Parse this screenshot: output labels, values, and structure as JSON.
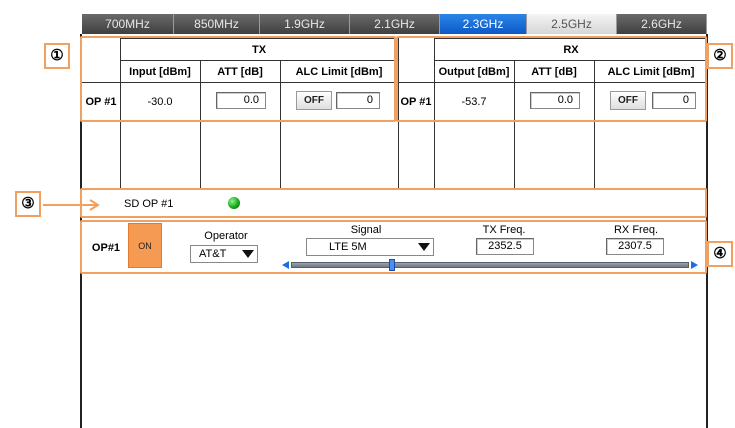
{
  "tabs": [
    {
      "label": "700MHz"
    },
    {
      "label": "850MHz"
    },
    {
      "label": "1.9GHz"
    },
    {
      "label": "2.1GHz"
    },
    {
      "label": "2.3GHz"
    },
    {
      "label": "2.5GHz"
    },
    {
      "label": "2.6GHz"
    }
  ],
  "active_tab": "2.3GHz",
  "tx": {
    "title": "TX",
    "col_input": "Input [dBm]",
    "col_att": "ATT [dB]",
    "col_alc": "ALC Limit [dBm]",
    "row_label": "OP #1",
    "input_value": "-30.0",
    "att_value": "0.0",
    "alc_button": "OFF",
    "alc_value": "0"
  },
  "rx": {
    "title": "RX",
    "col_output": "Output [dBm]",
    "col_att": "ATT [dB]",
    "col_alc": "ALC Limit [dBm]",
    "row_label": "OP #1",
    "output_value": "-53.7",
    "att_value": "0.0",
    "alc_button": "OFF",
    "alc_value": "0"
  },
  "sd": {
    "label": "SD OP #1",
    "status_color": "#1aa81a"
  },
  "op": {
    "label": "OP#1",
    "power_button": "ON",
    "operator_label": "Operator",
    "operator_value": "AT&T",
    "signal_label": "Signal",
    "signal_value": "LTE 5M",
    "tx_freq_label": "TX Freq.",
    "tx_freq_value": "2352.5",
    "rx_freq_label": "RX Freq.",
    "rx_freq_value": "2307.5"
  },
  "callouts": [
    "①",
    "②",
    "③",
    "④"
  ],
  "colors": {
    "callout": "#f0a060",
    "tab_active": "#1a6fe0",
    "on_button": "#f59a52"
  }
}
